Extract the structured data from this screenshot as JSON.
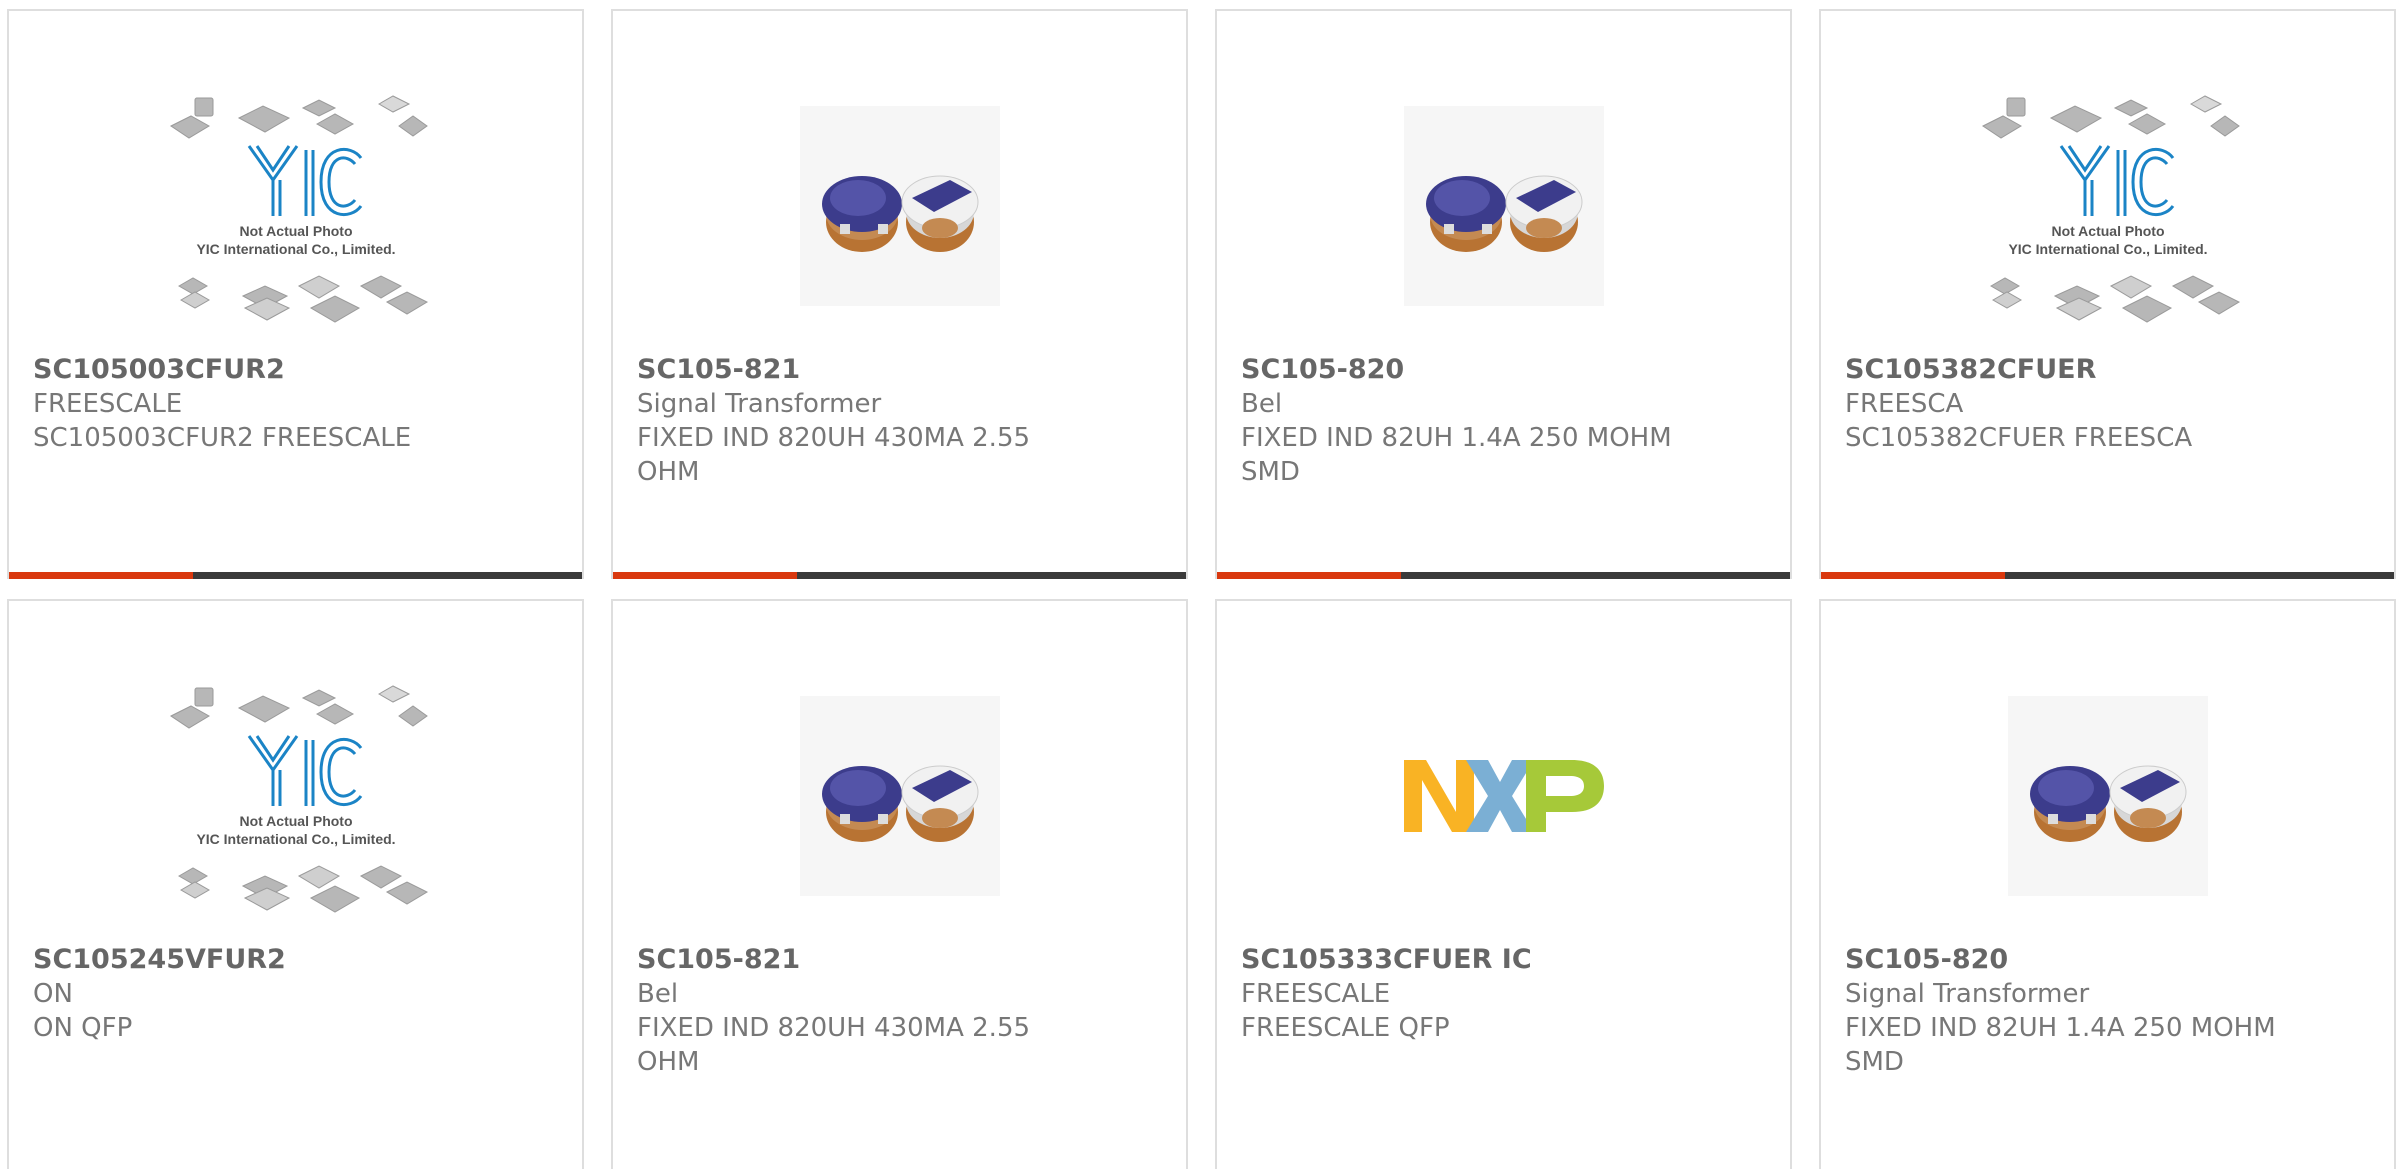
{
  "products": [
    {
      "part": "SC105003CFUR2",
      "brand": "FREESCALE",
      "desc": "SC105003CFUR2 FREESCALE",
      "image": "yic-placeholder",
      "photo_caption_1": "Not Actual Photo",
      "photo_caption_2": "YIC International Co., Limited."
    },
    {
      "part": "SC105-821",
      "brand": "Signal Transformer",
      "desc": "FIXED IND 820UH 430MA 2.55 OHM",
      "image": "inductor-photo"
    },
    {
      "part": "SC105-820",
      "brand": "Bel",
      "desc": "FIXED IND 82UH 1.4A 250 MOHM SMD",
      "image": "inductor-photo"
    },
    {
      "part": "SC105382CFUER",
      "brand": "FREESCA",
      "desc": "SC105382CFUER FREESCA",
      "image": "yic-placeholder",
      "photo_caption_1": "Not Actual Photo",
      "photo_caption_2": "YIC International Co., Limited."
    },
    {
      "part": "SC105245VFUR2",
      "brand": "ON",
      "desc": "ON QFP",
      "image": "yic-placeholder",
      "photo_caption_1": "Not Actual Photo",
      "photo_caption_2": "YIC International Co., Limited."
    },
    {
      "part": "SC105-821",
      "brand": "Bel",
      "desc": "FIXED IND 820UH 430MA 2.55 OHM",
      "image": "inductor-photo"
    },
    {
      "part": "SC105333CFUER IC",
      "brand": "FREESCALE",
      "desc": "FREESCALE QFP",
      "image": "nxp-logo"
    },
    {
      "part": "SC105-820",
      "brand": "Signal Transformer",
      "desc": "FIXED IND 82UH 1.4A 250 MOHM SMD",
      "image": "inductor-photo"
    }
  ],
  "colors": {
    "accent_red": "#d9380e",
    "accent_dark": "#3a3a3a",
    "card_border": "#dedede"
  }
}
